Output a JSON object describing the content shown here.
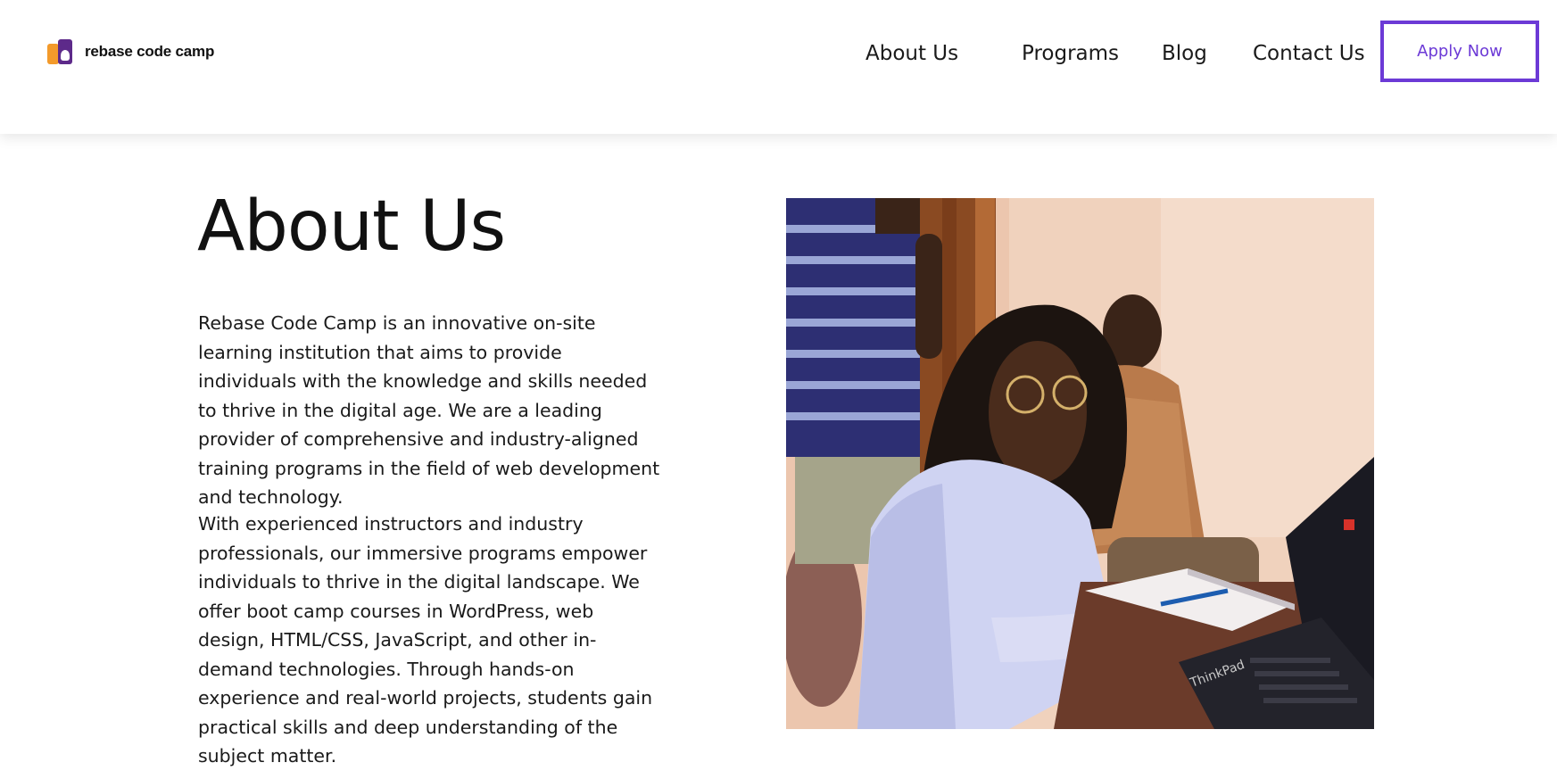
{
  "brand": {
    "name": "rebase code camp",
    "logo_icon": "rc-logo-icon",
    "colors": {
      "orange": "#f39a2b",
      "purple_dark": "#5d2a8a",
      "accent": "#6c3ad6"
    }
  },
  "nav": {
    "items": [
      {
        "label": "About Us"
      },
      {
        "label": "Programs"
      },
      {
        "label": "Blog"
      },
      {
        "label": "Contact Us"
      }
    ],
    "cta_label": "Apply Now"
  },
  "main": {
    "title": "About Us",
    "paragraphs": [
      "Rebase Code Camp is an innovative on-site learning institution that aims to provide individuals with the knowledge and skills needed to thrive in the digital age. We are a leading provider of comprehensive and industry-aligned training programs in the field of web development and technology.",
      "With experienced instructors and industry professionals, our immersive programs empower individuals to thrive in the digital landscape. We offer boot camp courses in WordPress, web design, HTML/CSS, JavaScript, and other in-demand technologies. Through hands-on experience and real-world projects, students gain practical skills and deep understanding of the subject matter."
    ],
    "photo_laptop_brand": "ThinkPad"
  }
}
